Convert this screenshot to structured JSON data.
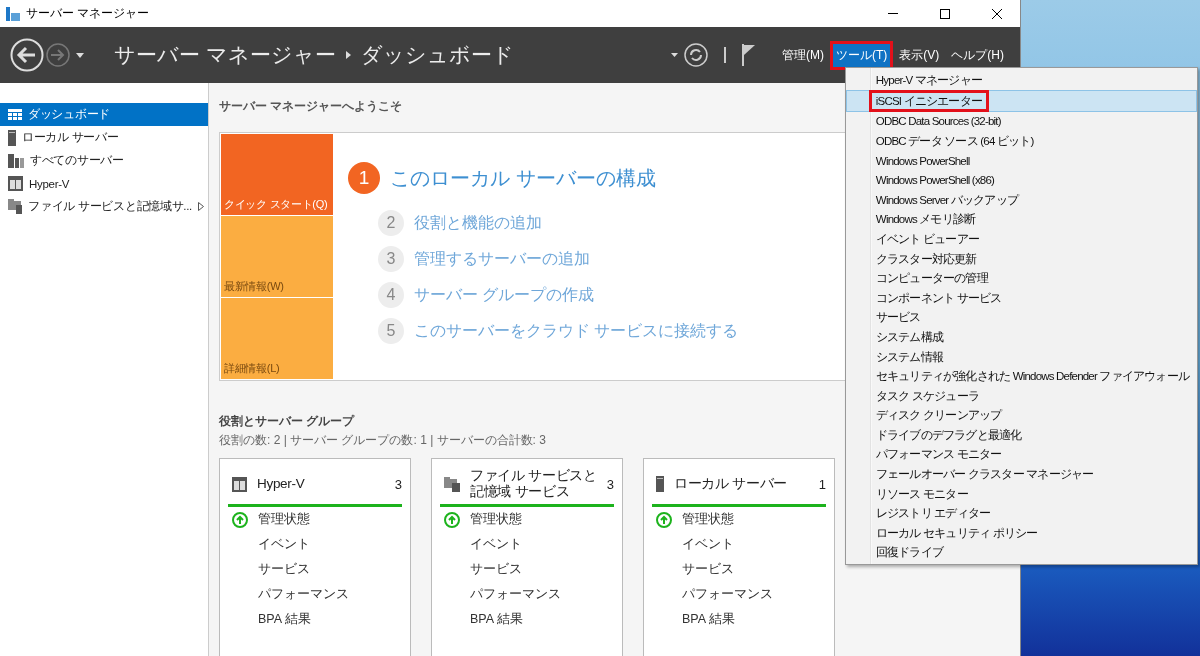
{
  "window": {
    "title": "サーバー マネージャー"
  },
  "header": {
    "breadcrumb": [
      "サーバー マネージャー",
      "ダッシュボード"
    ],
    "menus": [
      {
        "label": "管理(M)",
        "selected": false,
        "highlighted": false
      },
      {
        "label": "ツール(T)",
        "selected": true,
        "highlighted": true
      },
      {
        "label": "表示(V)",
        "selected": false,
        "highlighted": false
      },
      {
        "label": "ヘルプ(H)",
        "selected": false,
        "highlighted": false
      }
    ]
  },
  "sidebar": {
    "items": [
      {
        "label": "ダッシュボード",
        "kind": "dashboard",
        "selected": true,
        "expandable": false
      },
      {
        "label": "ローカル サーバー",
        "kind": "server",
        "selected": false,
        "expandable": false
      },
      {
        "label": "すべてのサーバー",
        "kind": "servers",
        "selected": false,
        "expandable": false
      },
      {
        "label": "Hyper-V",
        "kind": "hyperv",
        "selected": false,
        "expandable": false
      },
      {
        "label": "ファイル サービスと記憶域サ...",
        "kind": "files",
        "selected": false,
        "expandable": true
      }
    ]
  },
  "welcome": {
    "heading": "サーバー マネージャーへようこそ",
    "tiles": [
      {
        "label": "クイック スタート(Q)",
        "color": "#f26522",
        "selected": true
      },
      {
        "label": "最新情報(W)",
        "color": "#fbad41",
        "selected": false
      },
      {
        "label": "詳細情報(L)",
        "color": "#fbad41",
        "selected": false
      }
    ],
    "steps": [
      {
        "number": "1",
        "label": "このローカル サーバーの構成",
        "primary": true
      },
      {
        "number": "2",
        "label": "役割と機能の追加",
        "primary": false
      },
      {
        "number": "3",
        "label": "管理するサーバーの追加",
        "primary": false
      },
      {
        "number": "4",
        "label": "サーバー グループの作成",
        "primary": false
      },
      {
        "number": "5",
        "label": "このサーバーをクラウド サービスに接続する",
        "primary": false
      }
    ]
  },
  "roles": {
    "heading": "役割とサーバー グループ",
    "summary": "役割の数: 2 | サーバー グループの数: 1 | サーバーの合計数: 3",
    "cards": [
      {
        "title": "Hyper-V",
        "count": "3",
        "kind": "hyperv",
        "rows": [
          {
            "label": "管理状態",
            "healthy": true
          },
          {
            "label": "イベント"
          },
          {
            "label": "サービス"
          },
          {
            "label": "パフォーマンス"
          },
          {
            "label": "BPA 結果"
          }
        ]
      },
      {
        "title": "ファイル サービスと記憶域 サービス",
        "count": "3",
        "kind": "files",
        "rows": [
          {
            "label": "管理状態",
            "healthy": true
          },
          {
            "label": "イベント"
          },
          {
            "label": "サービス"
          },
          {
            "label": "パフォーマンス"
          },
          {
            "label": "BPA 結果"
          }
        ]
      },
      {
        "title": "ローカル サーバー",
        "count": "1",
        "kind": "server",
        "rows": [
          {
            "label": "管理状態",
            "healthy": true
          },
          {
            "label": "イベント"
          },
          {
            "label": "サービス"
          },
          {
            "label": "パフォーマンス"
          },
          {
            "label": "BPA 結果"
          }
        ]
      }
    ]
  },
  "tools_menu": {
    "items": [
      {
        "label": "Hyper-V マネージャー",
        "selected": false,
        "highlighted": false
      },
      {
        "label": "iSCSI イニシエーター",
        "selected": true,
        "highlighted": true
      },
      {
        "label": "ODBC Data Sources (32-bit)",
        "selected": false,
        "highlighted": false
      },
      {
        "label": "ODBC データ ソース (64 ビット)",
        "selected": false,
        "highlighted": false
      },
      {
        "label": "Windows PowerShell",
        "selected": false,
        "highlighted": false
      },
      {
        "label": "Windows PowerShell (x86)",
        "selected": false,
        "highlighted": false
      },
      {
        "label": "Windows Server バックアップ",
        "selected": false,
        "highlighted": false
      },
      {
        "label": "Windows メモリ診断",
        "selected": false,
        "highlighted": false
      },
      {
        "label": "イベント ビューアー",
        "selected": false,
        "highlighted": false
      },
      {
        "label": "クラスター対応更新",
        "selected": false,
        "highlighted": false
      },
      {
        "label": "コンピューターの管理",
        "selected": false,
        "highlighted": false
      },
      {
        "label": "コンポーネント サービス",
        "selected": false,
        "highlighted": false
      },
      {
        "label": "サービス",
        "selected": false,
        "highlighted": false
      },
      {
        "label": "システム構成",
        "selected": false,
        "highlighted": false
      },
      {
        "label": "システム情報",
        "selected": false,
        "highlighted": false
      },
      {
        "label": "セキュリティが強化された Windows Defender ファイアウォール",
        "selected": false,
        "highlighted": false
      },
      {
        "label": "タスク スケジューラ",
        "selected": false,
        "highlighted": false
      },
      {
        "label": "ディスク クリーンアップ",
        "selected": false,
        "highlighted": false
      },
      {
        "label": "ドライブのデフラグと最適化",
        "selected": false,
        "highlighted": false
      },
      {
        "label": "パフォーマンス モニター",
        "selected": false,
        "highlighted": false
      },
      {
        "label": "フェールオーバー クラスター マネージャー",
        "selected": false,
        "highlighted": false
      },
      {
        "label": "リソース モニター",
        "selected": false,
        "highlighted": false
      },
      {
        "label": "レジストリ エディター",
        "selected": false,
        "highlighted": false
      },
      {
        "label": "ローカル セキュリティ ポリシー",
        "selected": false,
        "highlighted": false
      },
      {
        "label": "回復ドライブ",
        "selected": false,
        "highlighted": false
      }
    ]
  }
}
